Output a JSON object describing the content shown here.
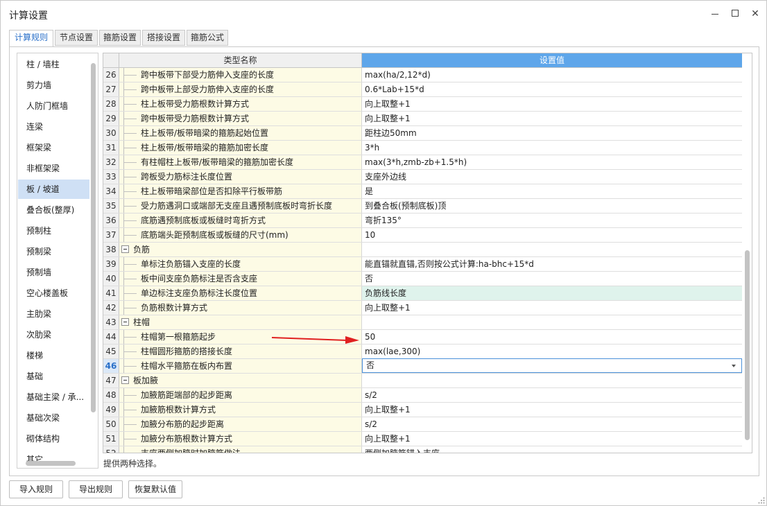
{
  "window": {
    "title": "计算设置"
  },
  "tabs": [
    {
      "label": "计算规则",
      "active": true
    },
    {
      "label": "节点设置",
      "active": false
    },
    {
      "label": "箍筋设置",
      "active": false
    },
    {
      "label": "搭接设置",
      "active": false
    },
    {
      "label": "箍筋公式",
      "active": false
    }
  ],
  "sidebar": {
    "selected": "板 / 坡道",
    "items": [
      "柱 / 墙柱",
      "剪力墙",
      "人防门框墙",
      "连梁",
      "框架梁",
      "非框架梁",
      "板 / 坡道",
      "叠合板(整厚)",
      "预制柱",
      "预制梁",
      "预制墙",
      "空心楼盖板",
      "主肋梁",
      "次肋梁",
      "楼梯",
      "基础",
      "基础主梁 / 承...",
      "基础次梁",
      "砌体结构",
      "其它"
    ]
  },
  "grid": {
    "columns": {
      "name": "类型名称",
      "value": "设置值"
    },
    "current_row": "46",
    "rows": [
      {
        "num": "26",
        "name": "跨中板带下部受力筋伸入支座的长度",
        "value": "max(ha/2,12*d)"
      },
      {
        "num": "27",
        "name": "跨中板带上部受力筋伸入支座的长度",
        "value": "0.6*Lab+15*d"
      },
      {
        "num": "28",
        "name": "柱上板带受力筋根数计算方式",
        "value": "向上取整+1"
      },
      {
        "num": "29",
        "name": "跨中板带受力筋根数计算方式",
        "value": "向上取整+1"
      },
      {
        "num": "30",
        "name": "柱上板带/板带暗梁的箍筋起始位置",
        "value": "距柱边50mm"
      },
      {
        "num": "31",
        "name": "柱上板带/板带暗梁的箍筋加密长度",
        "value": "3*h"
      },
      {
        "num": "32",
        "name": "有柱帽柱上板带/板带暗梁的箍筋加密长度",
        "value": "max(3*h,zmb-zb+1.5*h)"
      },
      {
        "num": "33",
        "name": "跨板受力筋标注长度位置",
        "value": "支座外边线"
      },
      {
        "num": "34",
        "name": "柱上板带暗梁部位是否扣除平行板带筋",
        "value": "是"
      },
      {
        "num": "35",
        "name": "受力筋遇洞口或端部无支座且遇预制底板时弯折长度",
        "value": "到叠合板(预制底板)顶"
      },
      {
        "num": "36",
        "name": "底筋遇预制底板或板缝时弯折方式",
        "value": "弯折135°"
      },
      {
        "num": "37",
        "name": "底筋端头距预制底板或板缝的尺寸(mm)",
        "value": "10"
      },
      {
        "num": "38",
        "name": "负筋",
        "value": "",
        "group": true
      },
      {
        "num": "39",
        "name": "单标注负筋锚入支座的长度",
        "value": "能直锚就直锚,否则按公式计算:ha-bhc+15*d"
      },
      {
        "num": "40",
        "name": "板中间支座负筋标注是否含支座",
        "value": "否"
      },
      {
        "num": "41",
        "name": "单边标注支座负筋标注长度位置",
        "value": "负筋线长度",
        "highlight": true
      },
      {
        "num": "42",
        "name": "负筋根数计算方式",
        "value": "向上取整+1"
      },
      {
        "num": "43",
        "name": "柱帽",
        "value": "",
        "group": true
      },
      {
        "num": "44",
        "name": "柱帽第一根箍筋起步",
        "value": "50"
      },
      {
        "num": "45",
        "name": "柱帽圆形箍筋的搭接长度",
        "value": "max(lae,300)"
      },
      {
        "num": "46",
        "name": "柱帽水平箍筋在板内布置",
        "value": "否",
        "editing": true
      },
      {
        "num": "47",
        "name": "板加腋",
        "value": "",
        "group": true
      },
      {
        "num": "48",
        "name": "加腋筋距端部的起步距离",
        "value": "s/2"
      },
      {
        "num": "49",
        "name": "加腋筋根数计算方式",
        "value": "向上取整+1"
      },
      {
        "num": "50",
        "name": "加腋分布筋的起步距离",
        "value": "s/2"
      },
      {
        "num": "51",
        "name": "加腋分布筋根数计算方式",
        "value": "向上取整+1"
      },
      {
        "num": "52",
        "name": "支座两侧加腋时加腋筋做法",
        "value": "两侧加腋筋锚入支座"
      }
    ]
  },
  "status_hint": "提供两种选择。",
  "buttons": {
    "import": "导入规则",
    "export": "导出规则",
    "reset": "恢复默认值"
  },
  "colors": {
    "header_accent": "#5ea6ea",
    "name_cell_bg": "#fdfbe5",
    "highlight_row": "#dff3ec",
    "annotation_arrow": "#e02020"
  },
  "icons": {
    "annotation": "red-arrow-icon",
    "dropdown": "chevron-down-icon"
  }
}
